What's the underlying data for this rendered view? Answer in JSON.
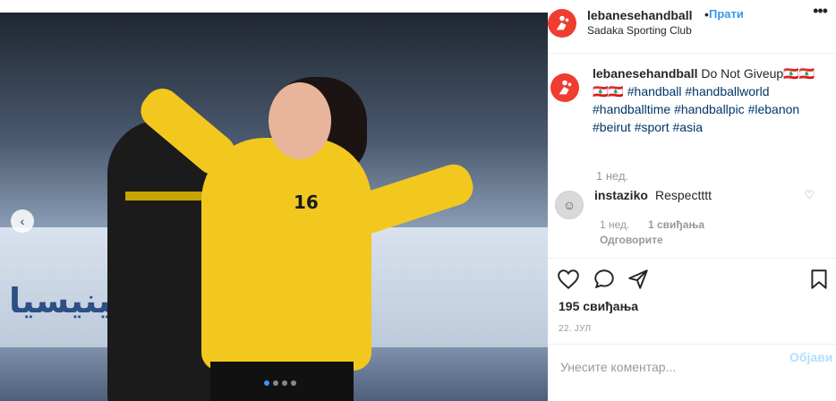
{
  "photo": {
    "board_text": "فينيسيا",
    "jersey_number": "16",
    "nav_prev_icon": "chevron-left-icon",
    "carousel": {
      "count": 4,
      "active_index": 0
    }
  },
  "header": {
    "username": "lebanesehandball",
    "separator": "•",
    "follow_label": "Прати",
    "location": "Sadaka Sporting Club",
    "more_label": "•••"
  },
  "caption": {
    "username": "lebanesehandball",
    "text": "Do Not Giveup🇱🇧🇱🇧🇱🇧🇱🇧",
    "hashtags": [
      "#handball",
      "#handballworld",
      "#handballtime",
      "#handballpic",
      "#lebanon",
      "#beirut",
      "#sport",
      "#asia"
    ],
    "time": "1 нед."
  },
  "comment": {
    "username": "instaziko",
    "text": "Respectttt",
    "time": "1 нед.",
    "likes": "1 свиђања",
    "reply_label": "Одговорите"
  },
  "actions": {
    "like_icon": "heart-icon",
    "comment_icon": "comment-bubble-icon",
    "share_icon": "share-icon",
    "save_icon": "bookmark-icon"
  },
  "likes_count": "195 свиђања",
  "date": "22. ЈУЛ",
  "comment_input": {
    "placeholder": "Унесите коментар...",
    "post_label": "Објави"
  },
  "colors": {
    "accent": "#3897f0",
    "brand_red": "#ef3d2f",
    "hashtag": "#003569",
    "muted": "#999999"
  }
}
